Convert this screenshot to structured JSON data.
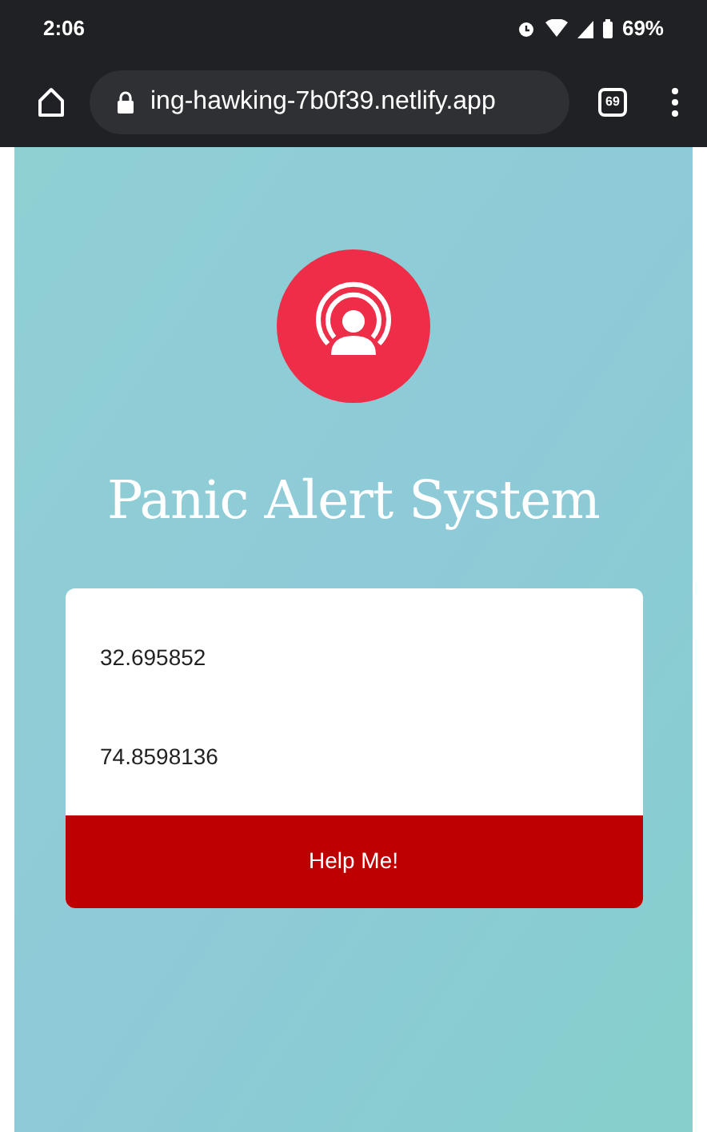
{
  "status_bar": {
    "time": "2:06",
    "battery": "69%"
  },
  "browser": {
    "url": "ing-hawking-7b0f39.netlify.app",
    "tab_count": "69"
  },
  "page": {
    "title": "Panic Alert System",
    "fields": [
      {
        "value": "32.695852"
      },
      {
        "value": "74.8598136"
      }
    ],
    "button": "Help Me!"
  }
}
